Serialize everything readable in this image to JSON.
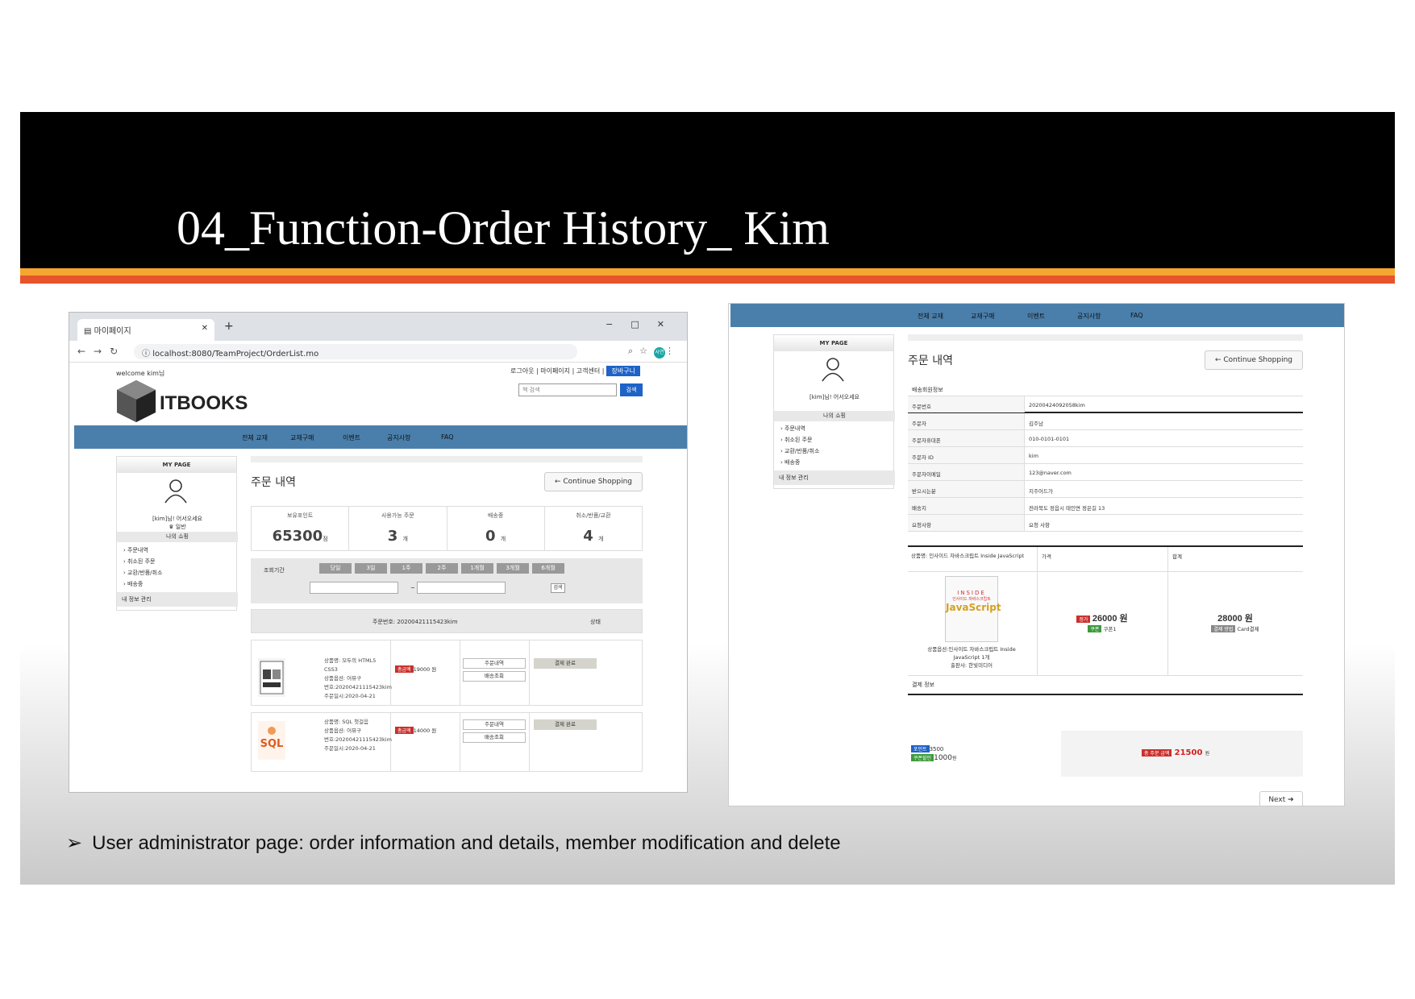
{
  "slide": {
    "title": "04_Function-Order History_ Kim",
    "caption": "User administrator page: order information and details,  member modification and delete",
    "bullet": "➢"
  },
  "browser": {
    "tab_title": "마이페이지",
    "url": "localhost:8080/TeamProject/OrderList.mo",
    "avatar": "사연"
  },
  "site": {
    "welcome": "welcome kim님",
    "top_links": "로그아웃 | 마이페이지 | 고객센터 |",
    "cart": "장바구니",
    "logo": "ITBOOKS",
    "search_placeholder": "책 검색",
    "search_btn": "검색",
    "nav": [
      "전체 교재",
      "교재구매",
      "이벤트",
      "공지사항",
      "FAQ"
    ]
  },
  "sidebar": {
    "header": "MY PAGE",
    "hello": "[kim]님! 어서오세요",
    "grade": "♛ 일반",
    "shopping": "나의 쇼핑",
    "items": [
      "주문내역",
      "취소된 주문",
      "교환/반품/취소",
      "배송중"
    ],
    "info": "내 정보 관리"
  },
  "orders": {
    "title": "주문 내역",
    "continue": "Continue Shopping",
    "stats": [
      {
        "label": "보유포인트",
        "value": "65300",
        "unit": "점"
      },
      {
        "label": "사용가능 주문",
        "value": "3",
        "unit": "개"
      },
      {
        "label": "배송중",
        "value": "0",
        "unit": "개"
      },
      {
        "label": "취소/반품/교환",
        "value": "4",
        "unit": "개"
      }
    ],
    "period_label": "조회기간",
    "periods": [
      "당일",
      "3일",
      "1주",
      "2주",
      "1개월",
      "3개월",
      "6개월"
    ],
    "tilde": "~",
    "go": "검색",
    "list_header": "주문번호: 20200421115423kim",
    "status_header": "상태",
    "rows": [
      {
        "lines": [
          "상품명: 모두의 HTML5",
          "CSS3",
          "상품옵션: 어뮤구",
          "번호:20200421115423kim",
          "주문일시:2020-04-21"
        ],
        "paid": "총금액",
        "amount": "19000 원",
        "btn1": "주문내역",
        "btn2": "배송조회",
        "status": "결제 완료"
      },
      {
        "lines": [
          "상품명: SQL 첫걸음",
          "상품옵션: 어뮤구",
          "번호:20200421115423kim",
          "주문일시:2020-04-21"
        ],
        "paid": "총금액",
        "amount": "14000 원",
        "btn1": "주문내역",
        "btn2": "배송조회",
        "status": "결제 완료"
      }
    ]
  },
  "detail": {
    "section": "배송회원정보",
    "rows": [
      {
        "k": "주문번호",
        "v": "20200424092058kim"
      },
      {
        "k": "주문자",
        "v": "김주남"
      },
      {
        "k": "주문자휴대폰",
        "v": "010-0101-0101"
      },
      {
        "k": "주문자 ID",
        "v": "kim"
      },
      {
        "k": "주문자이메일",
        "v": "123@naver.com"
      },
      {
        "k": "받으시는분",
        "v": "지주어드가"
      },
      {
        "k": "배송지",
        "v": "전라북도 정읍시 태인면 정은길 13"
      },
      {
        "k": "요청사항",
        "v": "요청 사항"
      }
    ],
    "prod_name": "상품명: 인사이드 자바스크립트 Inside JavaScript",
    "price_h": "가격",
    "total_h": "합계",
    "book_title": "JavaScript",
    "book_top": "INSIDE",
    "book_sub": "인사이드 자바스크립트",
    "prod_caption": [
      "상품옵션:인사이트 자바스크립트 Inside",
      "JavaScript 1개",
      "출판사: 한빛미디어"
    ],
    "price_badge": "정가",
    "price": "26000 원",
    "coupon_badge": "쿠폰",
    "coupon": "쿠폰1",
    "total": "28000 원",
    "card_badge": "결제 방법",
    "card": "Card결제",
    "pay_title": "결제 정보",
    "point_badge": "포인트",
    "point": "3500",
    "coupon_used_badge": "쿠폰할인",
    "coupon_used": "1000",
    "coupon_unit": "원",
    "final_badge": "총 주문 금액",
    "final": "21500",
    "final_unit": "원",
    "next": "Next ➔"
  }
}
